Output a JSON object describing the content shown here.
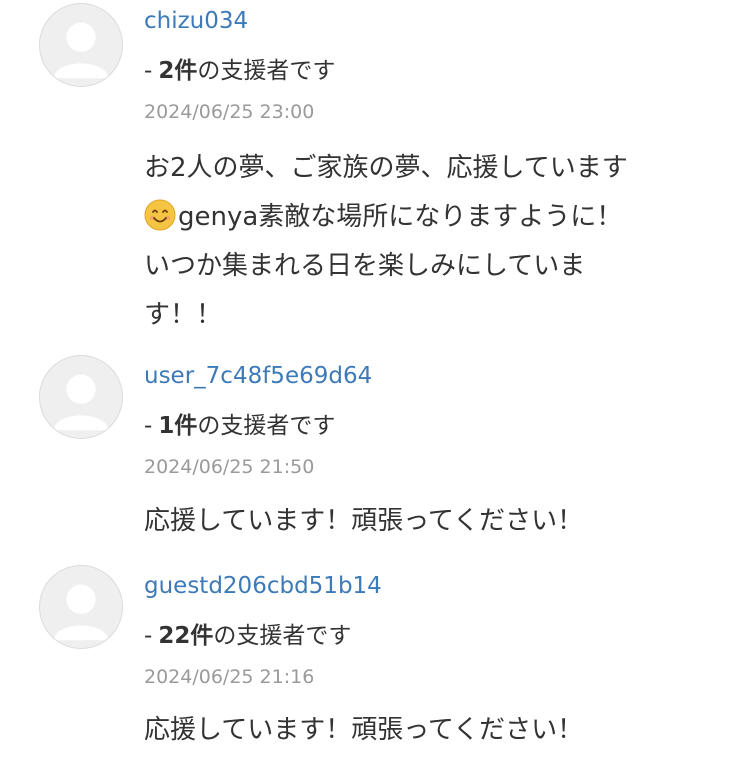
{
  "comments": [
    {
      "username": "chizu034",
      "supporter_prefix": "-",
      "supporter_count": "2件",
      "supporter_suffix": "の支援者です",
      "timestamp": "2024/06/25 23:00",
      "lines": [
        "お2人の夢、ご家族の夢、応援しています",
        "genya素敵な場所になりますように！",
        "いつか集まれる日を楽しみにしていま",
        "す！！"
      ],
      "emoji": "smiling-face-emoji"
    },
    {
      "username": "user_7c48f5e69d64",
      "supporter_prefix": "-",
      "supporter_count": "1件",
      "supporter_suffix": "の支援者です",
      "timestamp": "2024/06/25 21:50",
      "lines": [
        "応援しています！頑張ってください！"
      ]
    },
    {
      "username": "guestd206cbd51b14",
      "supporter_prefix": "-",
      "supporter_count": "22件",
      "supporter_suffix": "の支援者です",
      "timestamp": "2024/06/25 21:16",
      "lines": [
        "応援しています！頑張ってください！"
      ]
    }
  ],
  "colors": {
    "username_link": "#3d7ab8",
    "text": "#333333",
    "timestamp": "#9a9a9a",
    "avatar_bg": "#efefef",
    "avatar_silhouette": "#ffffff"
  },
  "icons": {
    "avatar": "default-user-avatar-icon"
  }
}
